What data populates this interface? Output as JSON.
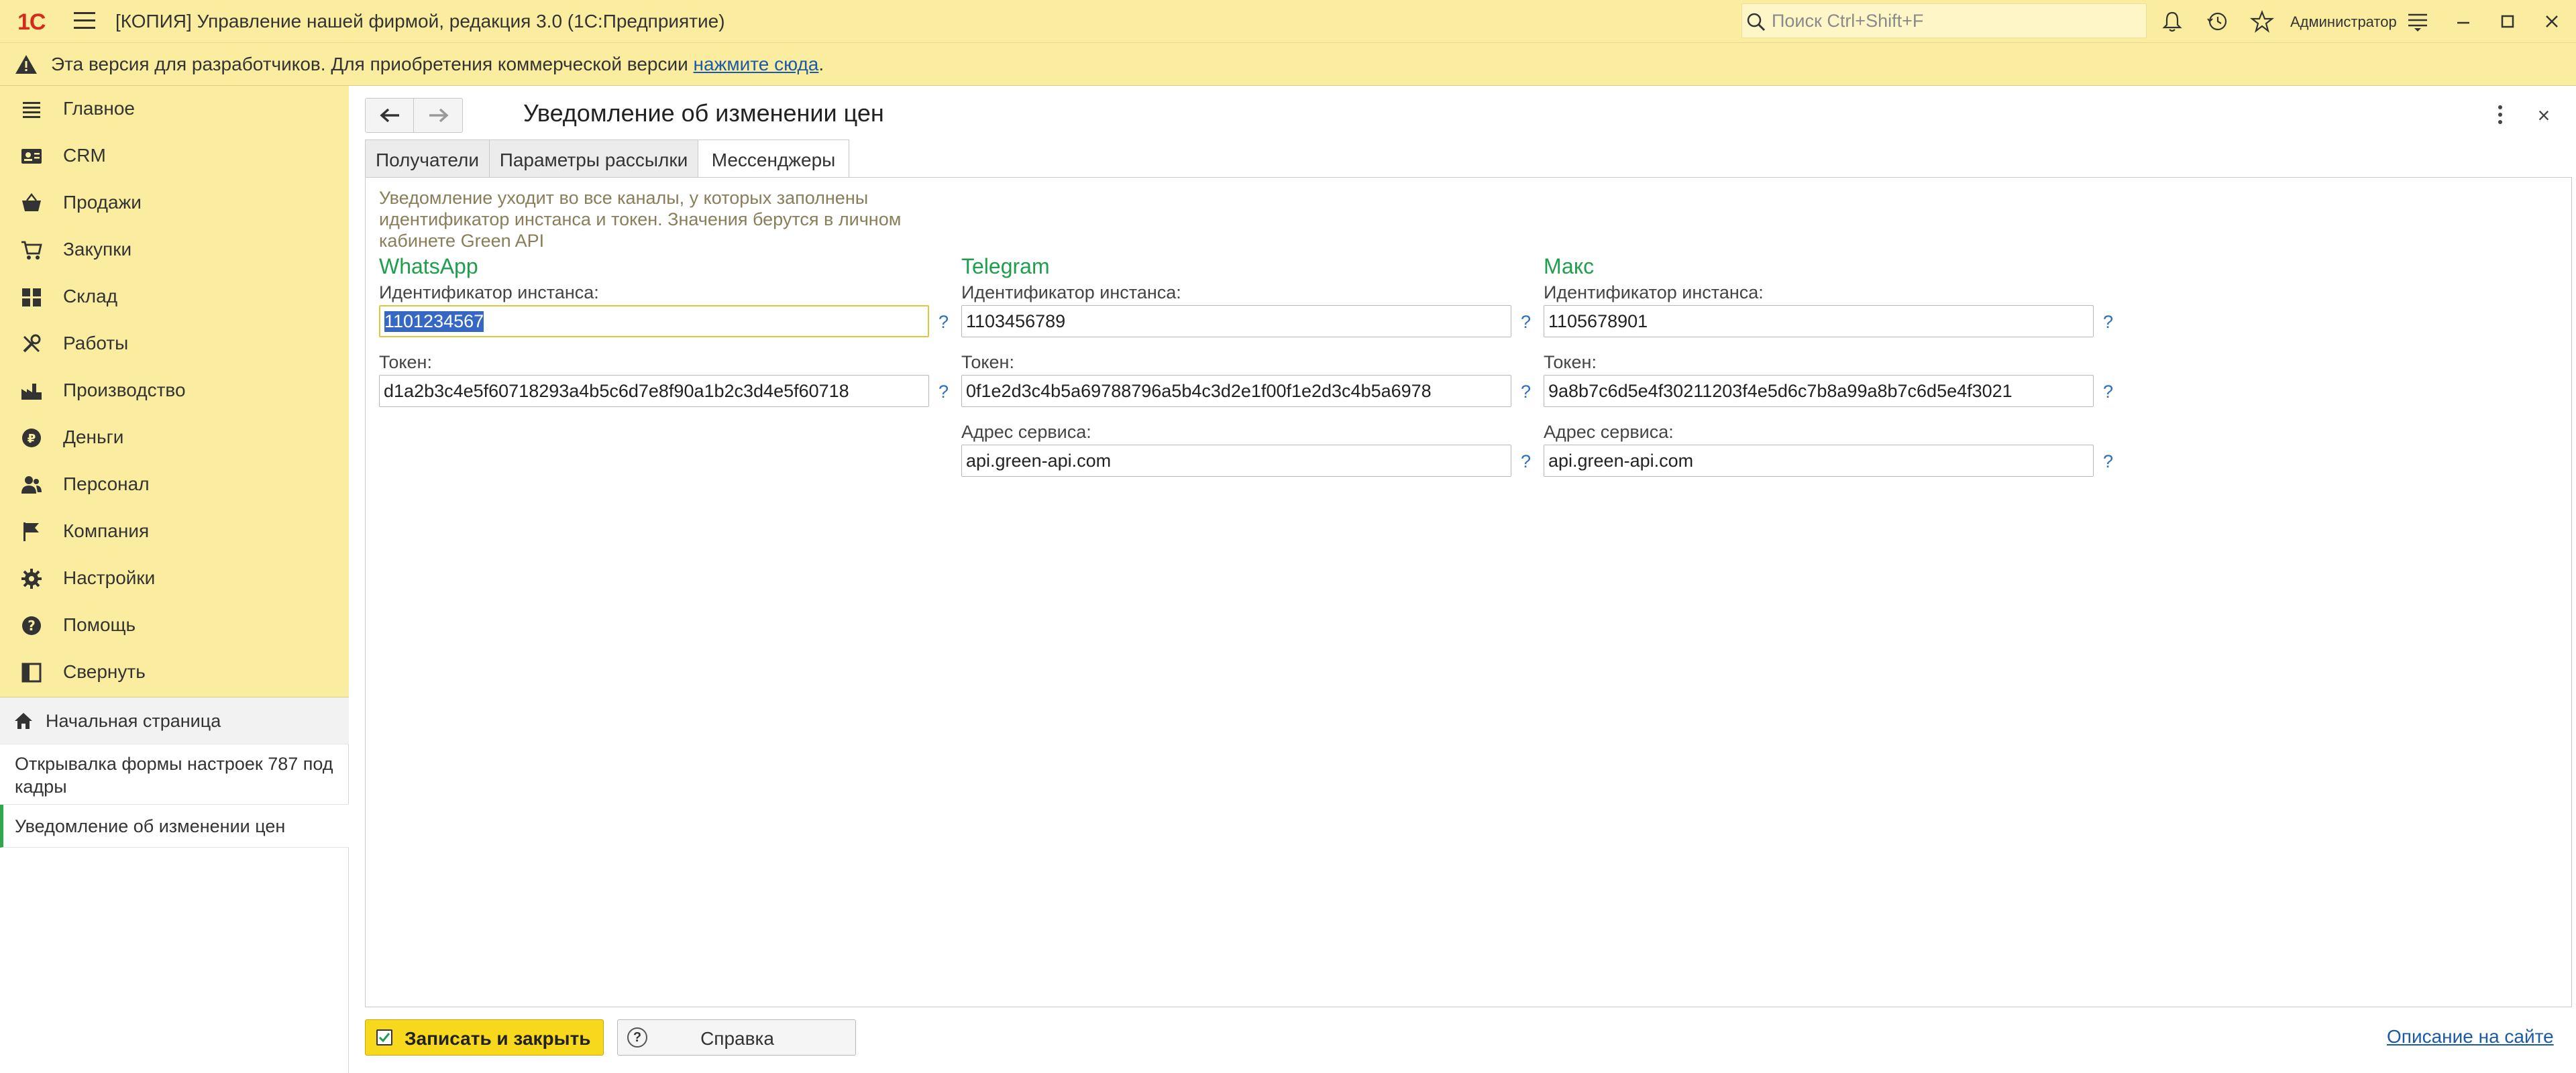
{
  "titlebar": {
    "logo": "1С",
    "title": "[КОПИЯ] Управление нашей фирмой, редакция 3.0  (1С:Предприятие)",
    "search_placeholder": "Поиск Ctrl+Shift+F",
    "user": "Администратор"
  },
  "notice": {
    "text": "Эта версия для разработчиков. Для приобретения коммерческой версии ",
    "link": "нажмите сюда",
    "tail": "."
  },
  "sidebar": {
    "items": [
      {
        "label": "Главное",
        "icon": "list-icon"
      },
      {
        "label": "CRM",
        "icon": "contact-card-icon"
      },
      {
        "label": "Продажи",
        "icon": "basket-icon"
      },
      {
        "label": "Закупки",
        "icon": "cart-icon"
      },
      {
        "label": "Склад",
        "icon": "grid-icon"
      },
      {
        "label": "Работы",
        "icon": "tools-icon"
      },
      {
        "label": "Производство",
        "icon": "factory-icon"
      },
      {
        "label": "Деньги",
        "icon": "coin-icon"
      },
      {
        "label": "Персонал",
        "icon": "people-icon"
      },
      {
        "label": "Компания",
        "icon": "flag-icon"
      },
      {
        "label": "Настройки",
        "icon": "gear-icon"
      },
      {
        "label": "Помощь",
        "icon": "help-icon"
      },
      {
        "label": "Свернуть",
        "icon": "collapse-icon"
      }
    ],
    "open": {
      "home": "Начальная страница",
      "item1": "Открывалка формы настроек 787 под кадры",
      "item2": "Уведомление об изменении цен"
    }
  },
  "form": {
    "title": "Уведомление об изменении цен",
    "tabs": [
      "Получатели",
      "Параметры рассылки",
      "Мессенджеры"
    ],
    "active_tab": "Мессенджеры",
    "hint": "Уведомление уходит во все каналы, у которых заполнены идентификатор инстанса и токен. Значения берутся в личном кабинете Green API",
    "columns": {
      "whatsapp": {
        "title": "WhatsApp",
        "instance_label": "Идентификатор инстанса:",
        "instance_value": "1101234567",
        "token_label": "Токен:",
        "token_value": "d1a2b3c4e5f60718293a4b5c6d7e8f90a1b2c3d4e5f60718"
      },
      "telegram": {
        "title": "Telegram",
        "instance_label": "Идентификатор инстанса:",
        "instance_value": "1103456789",
        "token_label": "Токен:",
        "token_value": "0f1e2d3c4b5a69788796a5b4c3d2e1f00f1e2d3c4b5a6978",
        "service_label": "Адрес сервиса:",
        "service_value": "api.green-api.com"
      },
      "max": {
        "title": "Макс",
        "instance_label": "Идентификатор инстанса:",
        "instance_value": "1105678901",
        "token_label": "Токен:",
        "token_value": "9a8b7c6d5e4f30211203f4e5d6c7b8a99a8b7c6d5e4f3021",
        "service_label": "Адрес сервиса:",
        "service_value": "api.green-api.com"
      }
    },
    "help_mark": "?",
    "save_label": "Записать и закрыть",
    "help_label": "Справка",
    "site_link": "Описание на сайте"
  },
  "colors": {
    "panel_yellow": "#fbeda0",
    "accent_green": "#1f9e4c",
    "primary_button": "#f8d81c",
    "link_blue": "#1a5aa8"
  }
}
